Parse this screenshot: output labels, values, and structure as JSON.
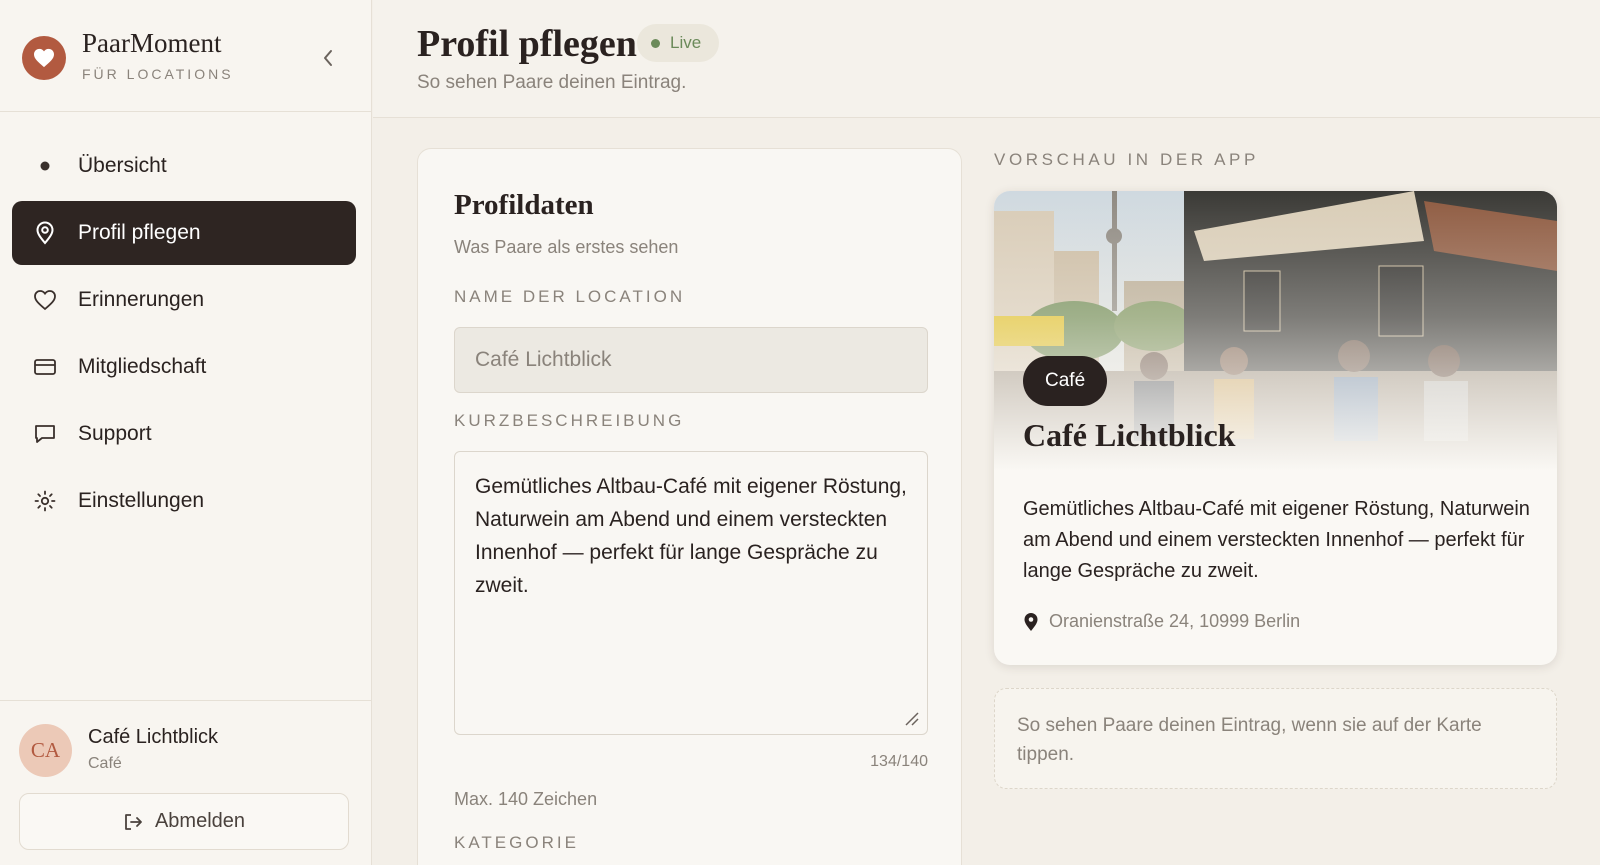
{
  "brand": {
    "name": "PaarMoment",
    "subtitle": "FÜR LOCATIONS",
    "accent": "#b25a40"
  },
  "nav": {
    "items": [
      {
        "label": "Übersicht",
        "icon": "dot-icon",
        "active": false
      },
      {
        "label": "Profil pflegen",
        "icon": "map-pin-icon",
        "active": true
      },
      {
        "label": "Erinnerungen",
        "icon": "heart-icon",
        "active": false
      },
      {
        "label": "Mitgliedschaft",
        "icon": "credit-card-icon",
        "active": false
      },
      {
        "label": "Support",
        "icon": "chat-icon",
        "active": false
      },
      {
        "label": "Einstellungen",
        "icon": "gear-icon",
        "active": false
      }
    ]
  },
  "user": {
    "initials": "CA",
    "name": "Café Lichtblick",
    "role": "Café",
    "logout_label": "Abmelden"
  },
  "header": {
    "title": "Profil pflegen",
    "status": "Live",
    "subtitle": "So sehen Paare deinen Eintrag."
  },
  "form": {
    "title": "Profildaten",
    "subtitle": "Was Paare als erstes sehen",
    "name_label": "NAME DER LOCATION",
    "name_value": "Café Lichtblick",
    "desc_label": "KURZBESCHREIBUNG",
    "desc_value": "Gemütliches Altbau-Café mit eigener Röstung, Naturwein am Abend und einem versteckten Innenhof — perfekt für lange Gespräche zu zweit.",
    "counter": "134/140",
    "hint": "Max. 140 Zeichen",
    "category_label": "KATEGORIE"
  },
  "preview": {
    "heading": "VORSCHAU IN DER APP",
    "category": "Café",
    "name": "Café Lichtblick",
    "description": "Gemütliches Altbau-Café mit eigener Röstung, Naturwein am Abend und einem versteckten Innenhof — perfekt für lange Gespräche zu zweit.",
    "address": "Oranienstraße 24, 10999 Berlin",
    "note": "So sehen Paare deinen Eintrag, wenn sie auf der Karte tippen."
  }
}
